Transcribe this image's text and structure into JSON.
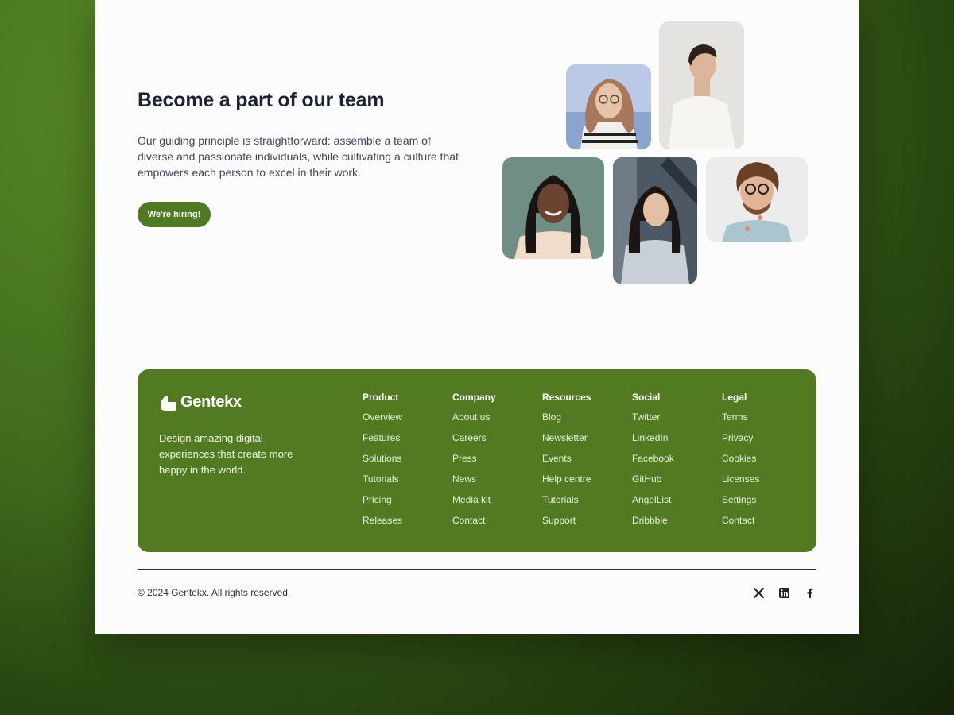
{
  "hero": {
    "title": "Become a part of our team",
    "body": "Our guiding principle is straightforward: assemble a team of diverse and passionate individuals, while cultivating a culture that empowers each person to excel in their work.",
    "cta_label": "We're hiring!"
  },
  "footer": {
    "brand": "Gentekx",
    "tagline": "Design amazing digital experiences that create more happy in the world.",
    "columns": [
      {
        "heading": "Product",
        "links": [
          "Overview",
          "Features",
          "Solutions",
          "Tutorials",
          "Pricing",
          "Releases"
        ]
      },
      {
        "heading": "Company",
        "links": [
          "About us",
          "Careers",
          "Press",
          "News",
          "Media kit",
          "Contact"
        ]
      },
      {
        "heading": "Resources",
        "links": [
          "Blog",
          "Newsletter",
          "Events",
          "Help centre",
          "Tutorials",
          "Support"
        ]
      },
      {
        "heading": "Social",
        "links": [
          "Twitter",
          "LinkedIn",
          "Facebook",
          "GitHub",
          "AngelList",
          "Dribbble"
        ]
      },
      {
        "heading": "Legal",
        "links": [
          "Terms",
          "Privacy",
          "Cookies",
          "Licenses",
          "Settings",
          "Contact"
        ]
      }
    ],
    "copyright": "© 2024 Gentekx. All rights reserved.",
    "social_icons": [
      "x-icon",
      "linkedin-icon",
      "facebook-icon"
    ]
  },
  "colors": {
    "brand_green": "#527a21",
    "button_green": "#4f7a21",
    "heading": "#1d2231"
  }
}
